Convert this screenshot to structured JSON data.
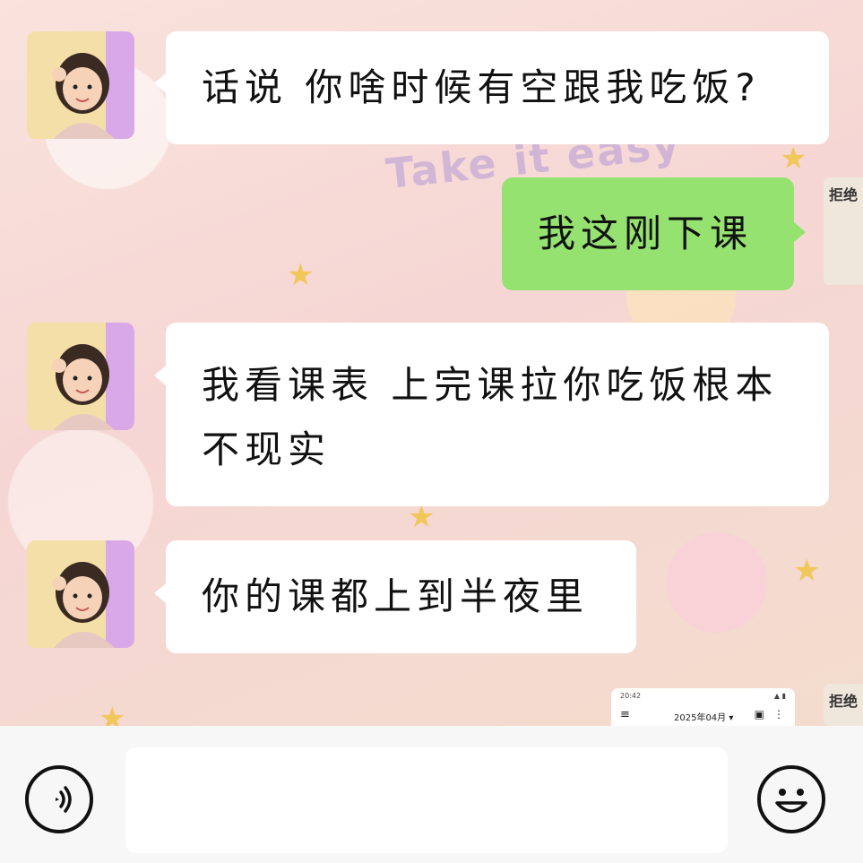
{
  "background": {
    "decoration_text": "Take it easy"
  },
  "messages": [
    {
      "side": "left",
      "text": "话说 你啥时候有空跟我吃饭?"
    },
    {
      "side": "right",
      "text": "我这刚下课"
    },
    {
      "side": "left",
      "text_lines": [
        "我看课表 上完课拉你吃饭根本",
        "不现实"
      ]
    },
    {
      "side": "left",
      "text": "你的课都上到半夜里"
    }
  ],
  "side_thumbnails": [
    {
      "label": "拒绝"
    },
    {
      "label": "拒绝"
    }
  ],
  "phone_thumbnail": {
    "status_time": "20:42",
    "month_label": "2025年04月 ▾"
  },
  "input_bar": {
    "voice_icon": "voice-icon",
    "emoji_icon": "emoji-icon",
    "input_value": ""
  },
  "colors": {
    "sent_bubble": "#95e270",
    "received_bubble": "#ffffff",
    "input_bar_bg": "#f7f7f7"
  }
}
